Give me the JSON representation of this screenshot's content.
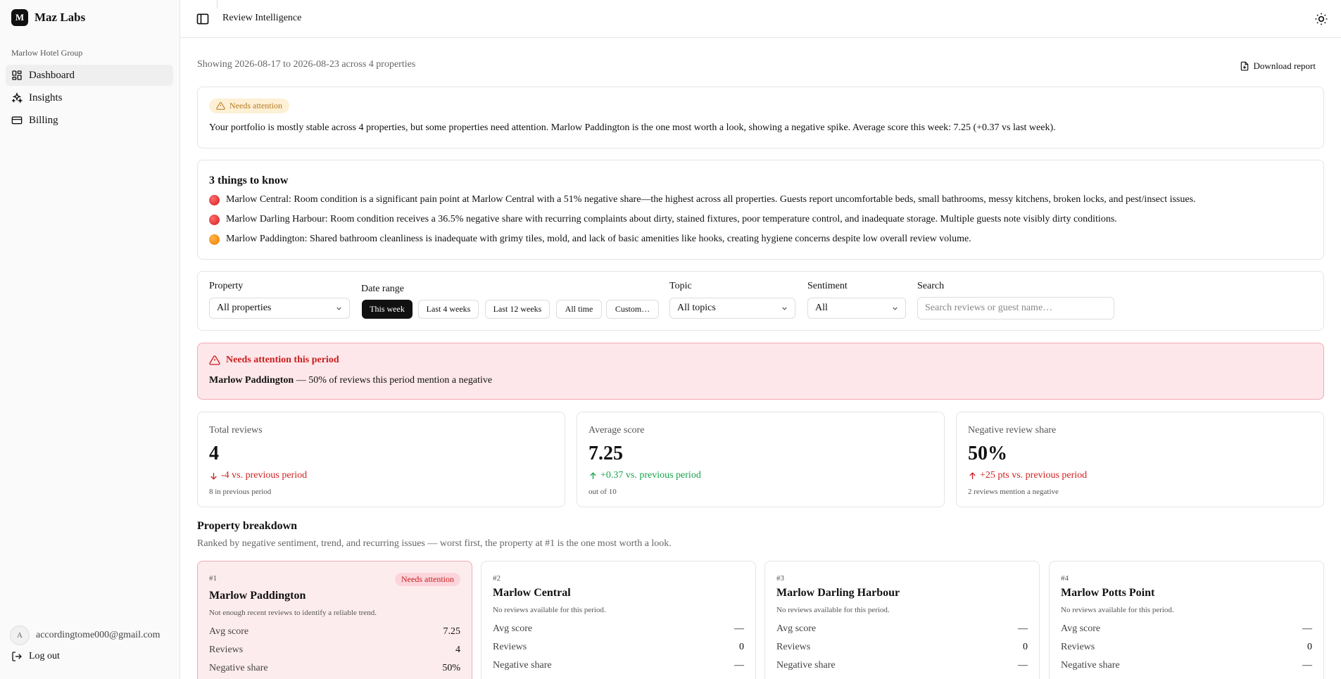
{
  "brand": {
    "logo_letter": "M",
    "name": "Maz Labs"
  },
  "sidebar": {
    "org": "Marlow Hotel Group",
    "items": [
      {
        "label": "Dashboard",
        "icon": "dashboard-icon"
      },
      {
        "label": "Insights",
        "icon": "sparkles-icon"
      },
      {
        "label": "Billing",
        "icon": "credit-card-icon"
      }
    ],
    "user": {
      "avatar_letter": "A",
      "email": "accordingtome000@gmail.com"
    },
    "logout_label": "Log out"
  },
  "header": {
    "title": "Review Intelligence"
  },
  "main": {
    "date_summary": "Showing 2026-08-17 to 2026-08-23 across 4 properties",
    "download_label": "Download report",
    "summary": {
      "badge": "Needs attention",
      "text": "Your portfolio is mostly stable across 4 properties, but some properties need attention. Marlow Paddington is the one most worth a look, showing a negative spike. Average score this week: 7.25 (+0.37 vs last week)."
    },
    "things": {
      "title": "3 things to know",
      "items": [
        {
          "text": "Marlow Central: Room condition is a significant pain point at Marlow Central with a 51% negative share—the highest across all properties. Guests report uncomfortable beds, small bathrooms, messy kitchens, broken locks, and pest/insect issues.",
          "severity": "red"
        },
        {
          "text": "Marlow Darling Harbour: Room condition receives a 36.5% negative share with recurring complaints about dirty, stained fixtures, poor temperature control, and inadequate storage. Multiple guests note visibly dirty conditions.",
          "severity": "red"
        },
        {
          "text": "Marlow Paddington: Shared bathroom cleanliness is inadequate with grimy tiles, mold, and lack of basic amenities like hooks, creating hygiene concerns despite low overall review volume.",
          "severity": "orange"
        }
      ]
    },
    "filters": {
      "property_label": "Property",
      "property_value": "All properties",
      "date_label": "Date range",
      "date_options": [
        "This week",
        "Last 4 weeks",
        "Last 12 weeks",
        "All time",
        "Custom…"
      ],
      "topic_label": "Topic",
      "topic_value": "All topics",
      "sentiment_label": "Sentiment",
      "sentiment_value": "All",
      "search_label": "Search",
      "search_placeholder": "Search reviews or guest name…"
    },
    "alert": {
      "title": "Needs attention this period",
      "property": "Marlow Paddington",
      "message": " — 50% of reviews this period mention a negative"
    },
    "stats": [
      {
        "label": "Total reviews",
        "value": "4",
        "delta": "-4 vs. previous period",
        "direction": "down",
        "tone": "red",
        "sub": "8 in previous period"
      },
      {
        "label": "Average score",
        "value": "7.25",
        "delta": "+0.37 vs. previous period",
        "direction": "up",
        "tone": "green",
        "sub": "out of 10"
      },
      {
        "label": "Negative review share",
        "value": "50%",
        "delta": "+25 pts vs. previous period",
        "direction": "up",
        "tone": "red",
        "sub": "2 reviews mention a negative"
      }
    ],
    "breakdown": {
      "title": "Property breakdown",
      "subtitle": "Ranked by negative sentiment, trend, and recurring issues — worst first, the property at #1 is the one most worth a look.",
      "row_labels": {
        "avg": "Avg score",
        "reviews": "Reviews",
        "neg": "Negative share"
      },
      "properties": [
        {
          "rank": "#1",
          "name": "Marlow Paddington",
          "badge": "Needs attention",
          "note": "Not enough recent reviews to identify a reliable trend.",
          "avg": "7.25",
          "reviews": "4",
          "neg": "50%"
        },
        {
          "rank": "#2",
          "name": "Marlow Central",
          "badge": "",
          "note": "No reviews available for this period.",
          "avg": "—",
          "reviews": "0",
          "neg": "—"
        },
        {
          "rank": "#3",
          "name": "Marlow Darling Harbour",
          "badge": "",
          "note": "No reviews available for this period.",
          "avg": "—",
          "reviews": "0",
          "neg": "—"
        },
        {
          "rank": "#4",
          "name": "Marlow Potts Point",
          "badge": "",
          "note": "No reviews available for this period.",
          "avg": "—",
          "reviews": "0",
          "neg": "—"
        }
      ]
    }
  }
}
